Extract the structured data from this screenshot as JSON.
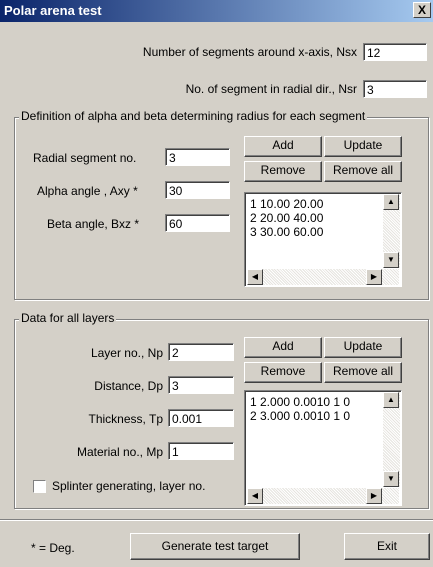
{
  "window": {
    "title": "Polar arena test",
    "close_symbol": "X"
  },
  "top": {
    "nsx_label": "Number of segments around x-axis, Nsx",
    "nsx_value": "12",
    "nsr_label": "No. of segment in radial dir., Nsr",
    "nsr_value": "3"
  },
  "alpha_group": {
    "title": "Definition of alpha and beta determining radius for each segment",
    "radial_label": "Radial segment no.",
    "radial_value": "3",
    "alpha_label": "Alpha angle , Axy *",
    "alpha_value": "30",
    "beta_label": "Beta angle, Bxz *",
    "beta_value": "60",
    "add_label": "Add",
    "update_label": "Update",
    "remove_label": "Remove",
    "remove_all_label": "Remove all",
    "list": [
      "1 10.00 20.00",
      "2 20.00 40.00",
      "3 30.00 60.00"
    ]
  },
  "layers_group": {
    "title": "Data for all layers",
    "layer_label": "Layer no., Np",
    "layer_value": "2",
    "distance_label": "Distance, Dp",
    "distance_value": "3",
    "thickness_label": "Thickness, Tp",
    "thickness_value": "0.001",
    "material_label": "Material no., Mp",
    "material_value": "1",
    "splinter_label": "Splinter generating, layer no.",
    "add_label": "Add",
    "update_label": "Update",
    "remove_label": "Remove",
    "remove_all_label": "Remove all",
    "list": [
      "1 2.000 0.0010 1 0",
      "2 3.000 0.0010 1 0"
    ]
  },
  "footer": {
    "deg_note": "* = Deg.",
    "generate_label": "Generate test target",
    "exit_label": "Exit"
  },
  "colors": {
    "titlebar_start": "#0a246a",
    "titlebar_end": "#a6caf0",
    "face": "#d4d0c8"
  }
}
